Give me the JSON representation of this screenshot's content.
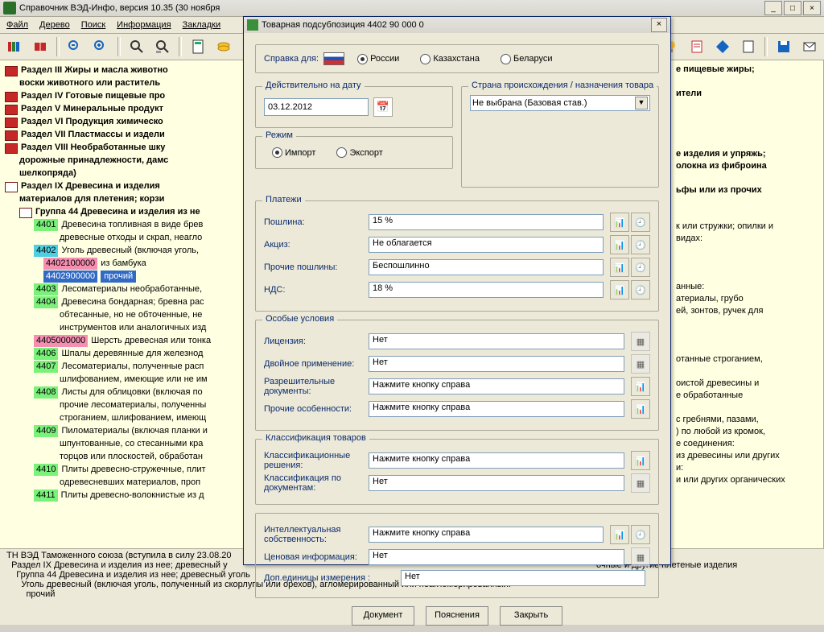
{
  "app_title": "Справочник ВЭД-Инфо, версия 10.35 (30 ноября",
  "menu": {
    "file": "Файл",
    "tree": "Дерево",
    "search": "Поиск",
    "info": "Информация",
    "bookmarks": "Закладки"
  },
  "tree_sections": {
    "s3": "Раздел III Жиры и масла животно",
    "s3b": "воски животного или раститель",
    "s4": "Раздел IV Готовые пищевые про",
    "s5": "Раздел V Минеральные продукт",
    "s6": "Раздел VI Продукция химическо",
    "s7": "Раздел VII Пластмассы и издели",
    "s8": "Раздел VIII Необработанные шку",
    "s8b": "дорожные принадлежности, дамс",
    "s8c": "шелкопряда)",
    "s9": "Раздел IX Древесина и изделия ",
    "s9b": "материалов для плетения; корзи",
    "g44": "Группа 44 Древесина и изделия из не"
  },
  "tree_right": {
    "r1": "е пищевые жиры;",
    "r2": "ители",
    "r3": "е изделия и упряжь;",
    "r4": "олокна из фиброина",
    "r5": "ьфы или из прочих",
    "r6": "к или стружки; опилки и",
    "r7": " видах:",
    "r8": "анные:",
    "r9": "атериалы, грубо",
    "r10": "ей, зонтов, ручек для",
    "r11": "отанные строганием,",
    "r12": "оистой древесины и",
    "r13": "е обработанные",
    "r14": "с гребнями, пазами,",
    "r15": ") по любой из кромок,",
    "r16": "е соединения:",
    "r17": "из древесины или других",
    "r18": "и:",
    "r19": "и или других органических"
  },
  "items44": [
    {
      "code": "4401",
      "cls": "green",
      "text": "Древесина топливная в виде брев",
      "text2": "древесные отходы и скрап, неагло"
    },
    {
      "code": "4402",
      "cls": "cyan",
      "text": "Уголь древесный (включая уголь, "
    },
    {
      "code": "4402100000",
      "cls": "pink",
      "text": "из бамбука",
      "indent": 3
    },
    {
      "code": "4402900000",
      "cls": "sel",
      "text": "прочий",
      "indent": 3,
      "selected": true
    },
    {
      "code": "4403",
      "cls": "green",
      "text": "Лесоматериалы необработанные, "
    },
    {
      "code": "4404",
      "cls": "green",
      "text": "Древесина бондарная; бревна рас",
      "text2": "обтесанные, но не обточенные, не ",
      "text3": "инструментов или аналогичных изд"
    },
    {
      "code": "4405000000",
      "cls": "pink",
      "text": "Шерсть древесная или тонка"
    },
    {
      "code": "4406",
      "cls": "green",
      "text": "Шпалы деревянные для железнод"
    },
    {
      "code": "4407",
      "cls": "green",
      "text": "Лесоматериалы, полученные расп",
      "text2": "шлифованием, имеющие или не им"
    },
    {
      "code": "4408",
      "cls": "green",
      "text": "Листы для облицовки (включая по",
      "text2": "прочие лесоматериалы, полученны",
      "text3": "строганием, шлифованием, имеющ"
    },
    {
      "code": "4409",
      "cls": "green",
      "text": "Пиломатериалы (включая планки и",
      "text2": "шпунтованные, со стесанными кра",
      "text3": "торцов или плоскостей, обработан"
    },
    {
      "code": "4410",
      "cls": "green",
      "text": "Плиты древесно-стружечные, плит",
      "text2": "одревесневших материалов, проп"
    },
    {
      "code": "4411",
      "cls": "green",
      "text": "Плиты древесно-волокнистые из д"
    }
  ],
  "footer_text": "ТН ВЭД Таможенного союза (вступила в силу 23.08.20\n  Раздел IX Древесина и изделия из нее; древесный у                                                                                                                                                      очные и другие плетеные изделия\n    Группа 44 Древесина и изделия из нее; древесный уголь\n      Уголь древесный (включая уголь, полученный из скорлупы или орехов), агломерированный или неагломерированный:\n        прочий",
  "dialog": {
    "title": "Товарная подсубпозиция 4402 90 000 0",
    "ref_for": "Справка для:",
    "russia": "России",
    "kaz": "Казахстана",
    "bel": "Беларуси",
    "date_group": "Действительно на дату",
    "date": "03.12.2012",
    "mode": "Режим",
    "import": "Импорт",
    "export": "Экспорт",
    "origin_group": "Страна происхождения / назначения товара",
    "origin_val": "Не выбрана (Базовая став.)",
    "payments": "Платежи",
    "duty_l": "Пошлина:",
    "duty_v": "15 %",
    "excise_l": "Акциз:",
    "excise_v": "Не облагается",
    "other_l": "Прочие пошлины:",
    "other_v": "Беспошлинно",
    "vat_l": "НДС:",
    "vat_v": "18 %",
    "special": "Особые условия",
    "lic_l": "Лицензия:",
    "no": "Нет",
    "dual_l": "Двойное применение:",
    "perm_l": "Разрешительные документы:",
    "press": "Нажмите кнопку справа",
    "otherfeat_l": "Прочие особенности:",
    "classif": "Классификация товаров",
    "class_l": "Классификационные решения:",
    "classdoc_l": "Классификация по документам:",
    "ip_l": "Интеллектуальная собственность:",
    "price_l": "Ценовая информация:",
    "units_l": "Доп.единицы измерения :",
    "btn_doc": "Документ",
    "btn_expl": "Пояснения",
    "btn_close": "Закрыть"
  }
}
